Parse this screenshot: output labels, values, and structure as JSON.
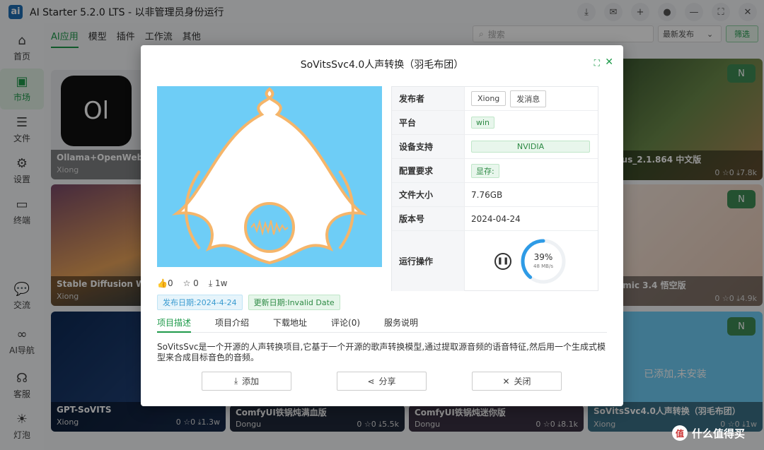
{
  "app": {
    "logo": "ai",
    "title": "AI Starter 5.2.0 LTS - 以非管理员身份运行",
    "title_icons": [
      "download-icon",
      "mail-icon",
      "plus-icon",
      "user-icon",
      "minimize-icon",
      "maximize-icon",
      "close-icon"
    ]
  },
  "sidebar": {
    "items": [
      {
        "label": "首页",
        "icon": "home-icon"
      },
      {
        "label": "市场",
        "icon": "store-icon"
      },
      {
        "label": "文件",
        "icon": "file-icon"
      },
      {
        "label": "设置",
        "icon": "gear-icon"
      },
      {
        "label": "终端",
        "icon": "terminal-icon"
      },
      {
        "label": "交流",
        "icon": "chat-icon"
      },
      {
        "label": "AI导航",
        "icon": "link-icon"
      },
      {
        "label": "客服",
        "icon": "headset-icon"
      },
      {
        "label": "灯泡",
        "icon": "bulb-icon"
      }
    ]
  },
  "toolbar": {
    "tabs": [
      "AI应用",
      "模型",
      "插件",
      "工作流",
      "其他"
    ],
    "search_placeholder": "搜索",
    "sort_label": "最新发布",
    "filter_label": "筛选"
  },
  "cards": [
    {
      "name": "Ollama+OpenWebUI",
      "author": "Xiong"
    },
    {
      "name": "Stable Diffusion WebUI",
      "author": "Xiong"
    },
    {
      "name": "GPT-SoVITS",
      "author": "Xiong",
      "likes": "0",
      "stars": "0",
      "downloads": "1.3w"
    },
    {
      "name": "ComfyUI铁锅炖满血版",
      "author": "Dongu",
      "likes": "0",
      "stars": "0",
      "downloads": "5.5k"
    },
    {
      "name": "ComfyUI铁锅炖迷你版",
      "author": "Dongu",
      "likes": "0",
      "stars": "0",
      "downloads": "8.1k"
    },
    {
      "name": "SoVitsSvc4.0人声转换（羽毛布团）",
      "author": "Xiong",
      "status": "已添加,未安装",
      "likes": "0",
      "stars": "0",
      "downloads": "1w",
      "badge": "N"
    },
    {
      "name": "Fooocus_2.1.864 中文版",
      "likes": "0",
      "stars": "0",
      "downloads": "7.8k",
      "badge": "N"
    },
    {
      "name": "Academic 3.4 悟空版",
      "likes": "0",
      "stars": "0",
      "downloads": "4.9k",
      "badge": "N"
    }
  ],
  "modal": {
    "title": "SoVitsSvc4.0人声转换（羽毛布团）",
    "stats": {
      "likes": "0",
      "stars": "0",
      "downloads": "1w"
    },
    "publish_date": "发布日期:2024-4-24",
    "update_date": "更新日期:Invalid Date",
    "info": {
      "publisher_label": "发布者",
      "publisher_name": "Xiong",
      "message_button": "发消息",
      "platform_label": "平台",
      "platform_value": "win",
      "device_label": "设备支持",
      "device_value": "NVIDIA",
      "requirements_label": "配置要求",
      "requirements_value": "显存:",
      "filesize_label": "文件大小",
      "filesize_value": "7.76GB",
      "version_label": "版本号",
      "version_value": "2024-04-24",
      "run_label": "运行操作",
      "progress_percent": "39%",
      "progress_fraction": 0.39,
      "speed": "48 MB/s"
    },
    "tabs": [
      "项目描述",
      "项目介绍",
      "下载地址",
      "评论(0)",
      "服务说明"
    ],
    "description": "SoVitsSvc是一个开源的人声转换项目,它基于一个开源的歌声转换模型,通过提取源音频的语音特征,然后用一个生成式模型来合成目标音色的音频。",
    "actions": {
      "add": "添加",
      "share": "分享",
      "close": "关闭"
    }
  },
  "watermark": "什么值得买",
  "colors": {
    "accent": "#1e9a4a",
    "progress": "#2e9be6",
    "cover_bg": "#6ecdf6",
    "cover_outline": "#f5b56a"
  }
}
